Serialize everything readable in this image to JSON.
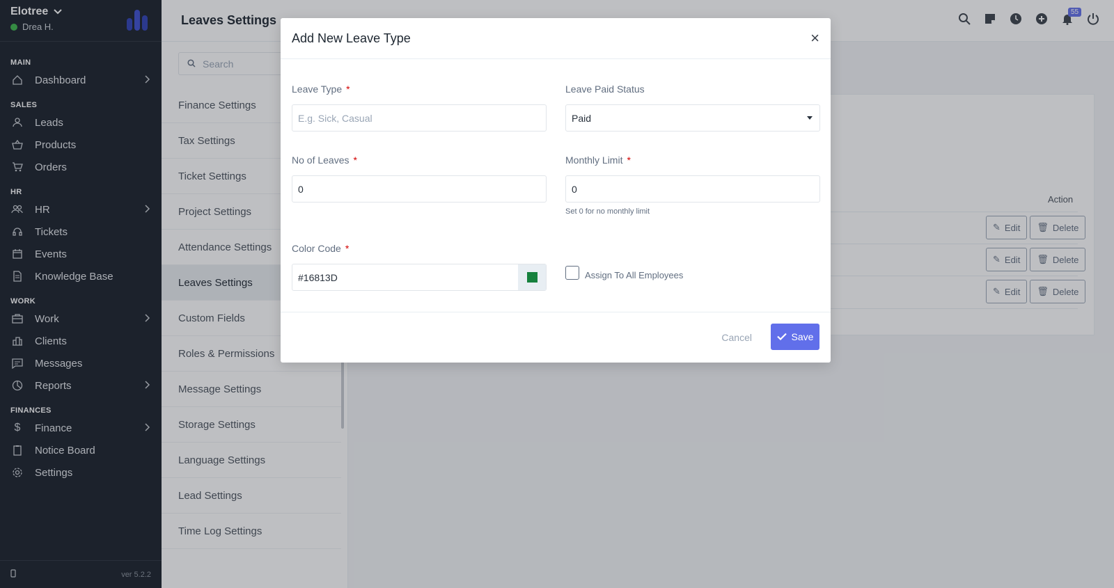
{
  "sidebar": {
    "company": "Elotree",
    "user": "Drea H.",
    "sections": {
      "main": "MAIN",
      "sales": "SALES",
      "hr": "HR",
      "work": "WORK",
      "finances": "FINANCES"
    },
    "items": {
      "dashboard": "Dashboard",
      "leads": "Leads",
      "products": "Products",
      "orders": "Orders",
      "hr": "HR",
      "tickets": "Tickets",
      "events": "Events",
      "knowledge_base": "Knowledge Base",
      "work": "Work",
      "clients": "Clients",
      "messages": "Messages",
      "reports": "Reports",
      "finance": "Finance",
      "notice_board": "Notice Board",
      "settings": "Settings"
    },
    "version": "ver 5.2.2"
  },
  "header": {
    "title": "Leaves Settings",
    "notification_count": "55"
  },
  "settings_menu": {
    "search_placeholder": "Search",
    "items": [
      "Finance Settings",
      "Tax Settings",
      "Ticket Settings",
      "Project Settings",
      "Attendance Settings",
      "Leaves Settings",
      "Custom Fields",
      "Roles & Permissions",
      "Message Settings",
      "Storage Settings",
      "Language Settings",
      "Lead Settings",
      "Time Log Settings"
    ]
  },
  "table": {
    "action_header": "Action",
    "edit_label": "Edit",
    "delete_label": "Delete"
  },
  "modal": {
    "title": "Add New Leave Type",
    "leave_type_label": "Leave Type",
    "leave_type_placeholder": "E.g. Sick, Casual",
    "paid_status_label": "Leave Paid Status",
    "paid_status_value": "Paid",
    "no_of_leaves_label": "No of Leaves",
    "no_of_leaves_value": "0",
    "monthly_limit_label": "Monthly Limit",
    "monthly_limit_value": "0",
    "monthly_limit_help": "Set 0 for no monthly limit",
    "color_code_label": "Color Code",
    "color_code_value": "#16813D",
    "assign_all_label": "Assign To All Employees",
    "cancel_label": "Cancel",
    "save_label": "Save",
    "required_mark": "*"
  },
  "colors": {
    "accent": "#616fea",
    "sidebar_bg": "#171f29",
    "swatch": "#16813D"
  }
}
